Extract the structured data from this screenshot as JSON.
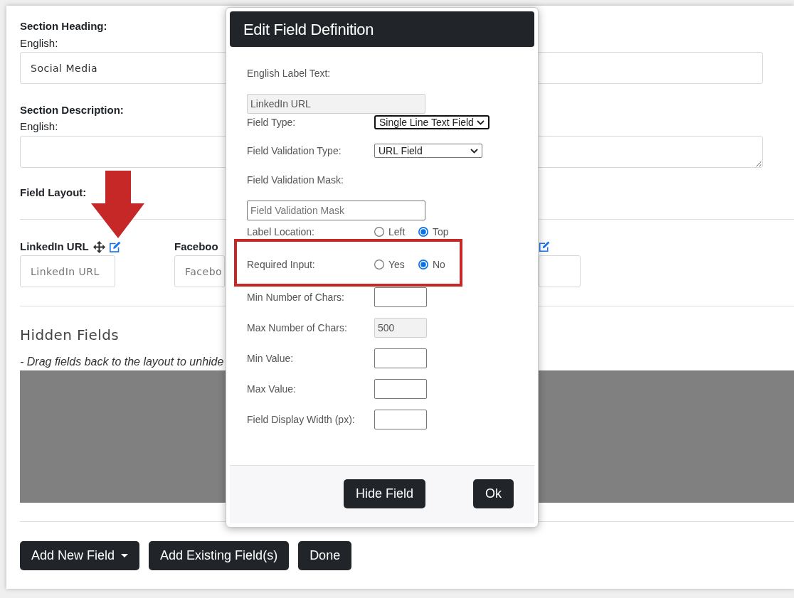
{
  "section_heading": {
    "label": "Section Heading:",
    "language": "English:",
    "value": "Social Media"
  },
  "section_description": {
    "label": "Section Description:",
    "language": "English:"
  },
  "field_layout": {
    "label": "Field Layout:",
    "fields": [
      {
        "label": "LinkedIn URL",
        "placeholder": "LinkedIn URL"
      },
      {
        "label": "Faceboo",
        "placeholder": "Facebo"
      }
    ]
  },
  "hidden_fields": {
    "title": "Hidden Fields",
    "hint": "- Drag fields back to the layout to unhide"
  },
  "buttons": [
    {
      "label": "Add New Field",
      "kind": "dropdown"
    },
    {
      "label": "Add Existing Field(s)",
      "kind": "plain"
    },
    {
      "label": "Done",
      "kind": "plain"
    }
  ],
  "dialog": {
    "title": "Edit Field Definition",
    "rows": [
      {
        "kind": "text_input",
        "label": "English Label Text:",
        "value": "LinkedIn URL",
        "readonly": true
      },
      {
        "kind": "select",
        "label": "Field Type:",
        "value": "Single Line Text Field",
        "focused": true
      },
      {
        "kind": "select",
        "label": "Field Validation Type:",
        "value": "URL Field",
        "focused": false
      },
      {
        "kind": "text_input",
        "label": "Field Validation Mask:",
        "placeholder": "Field Validation Mask",
        "readonly": false
      },
      {
        "kind": "radio",
        "label": "Label Location:",
        "options": [
          {
            "label": "Left",
            "selected": false
          },
          {
            "label": "Top",
            "selected": true
          }
        ]
      },
      {
        "kind": "radio",
        "label": "Required Input:",
        "options": [
          {
            "label": "Yes",
            "selected": false
          },
          {
            "label": "No",
            "selected": true
          }
        ]
      },
      {
        "kind": "small_input",
        "label": "Min Number of Chars:",
        "readonly": false
      },
      {
        "kind": "small_input",
        "label": "Max Number of Chars:",
        "value": "500",
        "readonly": true
      },
      {
        "kind": "small_input",
        "label": "Min Value:",
        "readonly": false
      },
      {
        "kind": "small_input",
        "label": "Max Value:",
        "readonly": false
      },
      {
        "kind": "small_input",
        "label": "Field Display Width (px):",
        "readonly": false
      }
    ],
    "buttons": [
      {
        "label": "Hide Field"
      },
      {
        "label": "Ok"
      }
    ]
  }
}
